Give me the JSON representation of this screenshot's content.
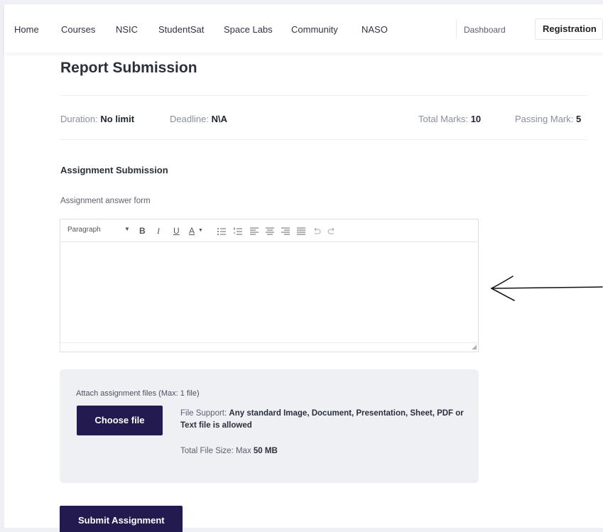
{
  "nav": {
    "items": [
      "Home",
      "Courses",
      "NSIC",
      "StudentSat",
      "Space Labs",
      "Community",
      "NASO"
    ],
    "dashboard": "Dashboard",
    "registration": "Registration"
  },
  "page_title": "Report Submission",
  "meta": {
    "duration_label": "Duration:",
    "duration_value": "No limit",
    "deadline_label": "Deadline:",
    "deadline_value": "N\\A",
    "total_label": "Total Marks:",
    "total_value": "10",
    "passing_label": "Passing Mark:",
    "passing_value": "5"
  },
  "section_title": "Assignment Submission",
  "form_label": "Assignment answer form",
  "editor": {
    "block_format": "Paragraph",
    "tools": [
      "bold",
      "italic",
      "underline",
      "text-color",
      "bullet-list",
      "numbered-list",
      "align-left",
      "align-center",
      "align-right",
      "justify",
      "undo",
      "redo"
    ]
  },
  "attach": {
    "label": "Attach assignment files (Max: 1 file)",
    "choose_label": "Choose file",
    "support_label": "File Support:",
    "support_value": "Any standard Image, Document, Presentation, Sheet, PDF or Text file is allowed",
    "size_label": "Total File Size: Max",
    "size_value": "50 MB"
  },
  "submit_label": "Submit Assignment",
  "colors": {
    "button": "#231a4f",
    "panel": "#eef0f4"
  }
}
